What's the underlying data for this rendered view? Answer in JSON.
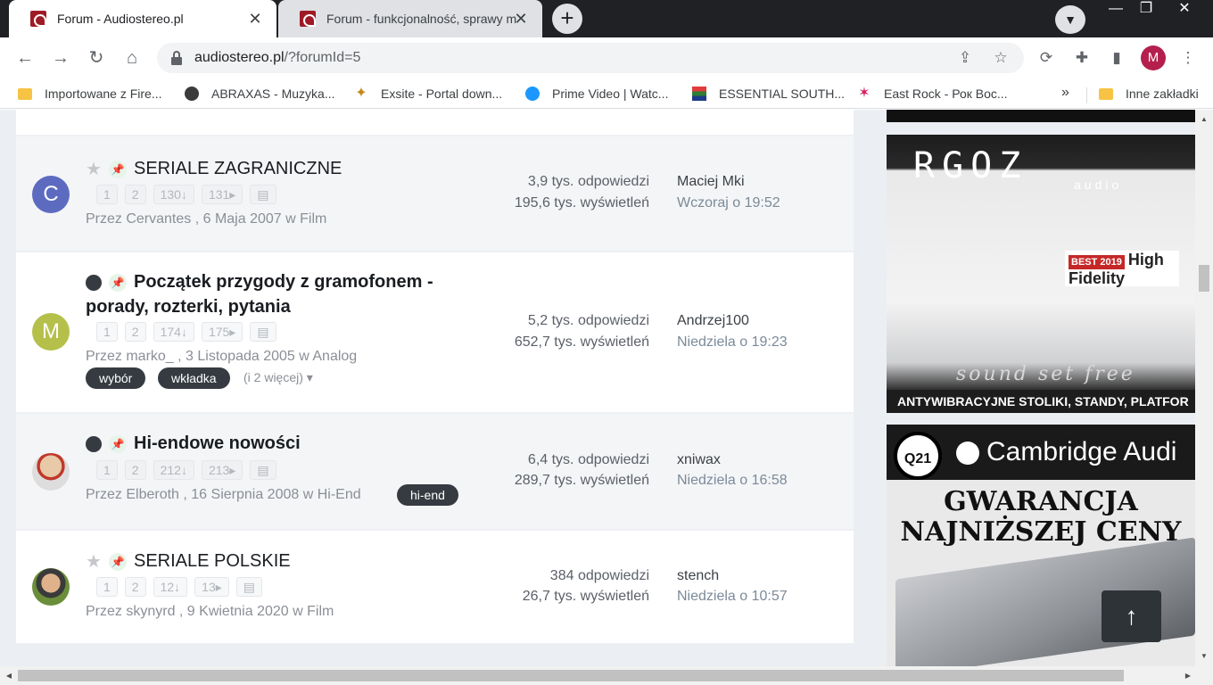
{
  "browser": {
    "tabs": [
      {
        "title": "Forum - Audiostereo.pl"
      },
      {
        "title": "Forum - funkcjonalność, sprawy m"
      }
    ],
    "url_host": "audiostereo.pl",
    "url_path": "/?forumId=5",
    "profile_initial": "M",
    "bookmarks": [
      {
        "label": "Importowane z Fire..."
      },
      {
        "label": "ABRAXAS - Muzyka..."
      },
      {
        "label": "Exsite - Portal down..."
      },
      {
        "label": "Prime Video | Watc..."
      },
      {
        "label": "ESSENTIAL SOUTH..."
      },
      {
        "label": "East Rock - Рок Вос..."
      }
    ],
    "bookmarks_overflow": "»",
    "other_bookmarks": "Inne zakładki"
  },
  "topics": [
    {
      "avatar_letter": "C",
      "avatar_color": "#5c6bc0",
      "title": "SERIALE ZAGRANICZNE",
      "pages": [
        "1",
        "2",
        "130↓",
        "131▸"
      ],
      "meta": "Przez Cervantes , 6 Maja 2007 w Film",
      "replies": "3,9 tys. odpowiedzi",
      "views": "195,6 tys. wyświetleń",
      "last_user": "Maciej Mki",
      "last_time": "Wczoraj o 19:52"
    },
    {
      "avatar_letter": "M",
      "avatar_color": "#b5c04a",
      "title_line1": "Początek przygody z gramofonem -",
      "title_line2": "porady, rozterki, pytania",
      "pages": [
        "1",
        "2",
        "174↓",
        "175▸"
      ],
      "meta": "Przez marko_ , 3 Listopada 2005 w Analog",
      "tags": [
        "wybór",
        "wkładka"
      ],
      "more_tags": "(i 2 więcej) ▾",
      "replies": "5,2 tys. odpowiedzi",
      "views": "652,7 tys. wyświetleń",
      "last_user": "Andrzej100",
      "last_time": "Niedziela o 19:23"
    },
    {
      "title": "Hi-endowe nowości",
      "pages": [
        "1",
        "2",
        "212↓",
        "213▸"
      ],
      "meta": "Przez Elberoth , 16 Sierpnia 2008 w Hi-End",
      "tags": [
        "hi-end"
      ],
      "replies": "6,4 tys. odpowiedzi",
      "views": "289,7 tys. wyświetleń",
      "last_user": "xniwax",
      "last_time": "Niedziela o 16:58"
    },
    {
      "title": "SERIALE POLSKIE",
      "pages": [
        "1",
        "2",
        "12↓",
        "13▸"
      ],
      "meta": "Przez skynyrd , 9 Kwietnia 2020 w Film",
      "replies": "384 odpowiedzi",
      "views": "26,7 tys. wyświetleń",
      "last_user": "stench",
      "last_time": "Niedziela o 10:57"
    }
  ],
  "ads": {
    "ad1_brand": "RGOZ",
    "ad1_sub": "audio",
    "ad1_best": "BEST 2019",
    "ad1_hf": "High Fidelity",
    "ad1_slogan": "sound set free",
    "ad1_footer": "ANTYWIBRACYJNE STOLIKI, STANDY, PLATFOR",
    "ad2_q21": "Q21",
    "ad2_brand": "Cambridge Audi",
    "ad2_line1": "GWARANCJA",
    "ad2_line2": "NAJNIŻSZEJ CENY"
  },
  "icons": {
    "back": "←",
    "forward": "→",
    "reload": "↻",
    "home": "⌂",
    "share": "⇪",
    "bookmark_star": "☆",
    "extensions": "✚",
    "menu": "⋮",
    "topic_star": "★",
    "pin": "✎",
    "fav_page": "▤",
    "scroll_top": "↑"
  }
}
